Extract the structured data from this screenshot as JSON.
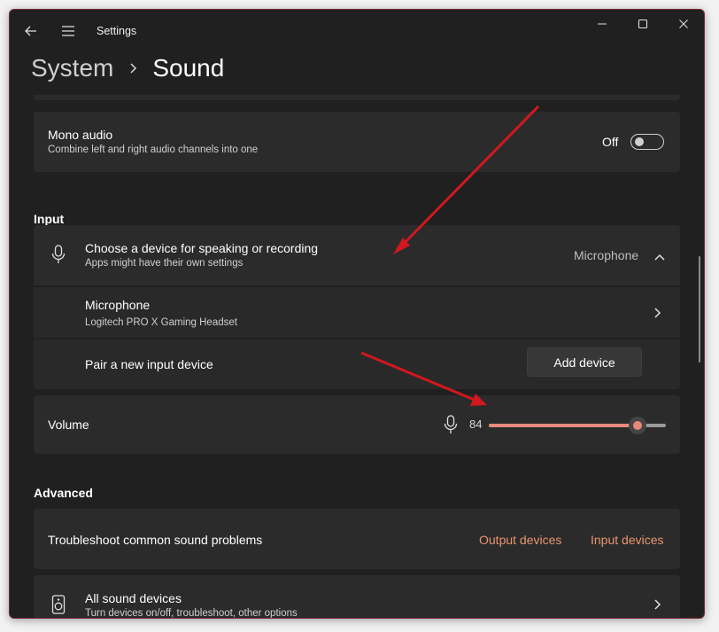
{
  "window": {
    "title": "Settings"
  },
  "breadcrumb": {
    "parent": "System",
    "current": "Sound"
  },
  "mono_audio": {
    "title": "Mono audio",
    "description": "Combine left and right audio channels into one",
    "state_label": "Off",
    "enabled": false
  },
  "input": {
    "section_title": "Input",
    "chooser_title": "Choose a device for speaking or recording",
    "chooser_subtitle": "Apps might have their own settings",
    "selected_device": "Microphone",
    "device_name": "Microphone",
    "device_detail": "Logitech PRO X Gaming Headset",
    "pair_label": "Pair a new input device",
    "add_device_label": "Add device",
    "volume_label": "Volume",
    "volume_value": "84",
    "volume_level": 0.84
  },
  "advanced": {
    "section_title": "Advanced",
    "troubleshoot_label": "Troubleshoot common sound problems",
    "output_devices_link": "Output devices",
    "input_devices_link": "Input devices",
    "all_devices_title": "All sound devices",
    "all_devices_subtitle": "Turn devices on/off, troubleshoot, other options"
  },
  "colors": {
    "accent": "#e8897a",
    "link": "#e8956f",
    "background": "#202020",
    "card": "#2b2b2b",
    "annotation_arrow": "#d0181e"
  },
  "icons": [
    "back-arrow-icon",
    "hamburger-menu-icon",
    "minimize-icon",
    "maximize-icon",
    "close-icon",
    "chevron-right-icon",
    "microphone-icon",
    "chevron-up-icon",
    "speaker-device-icon"
  ]
}
